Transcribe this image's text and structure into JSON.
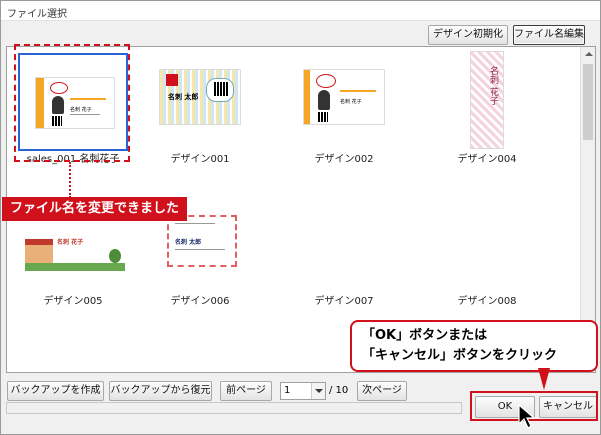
{
  "window": {
    "title": "ファイル選択"
  },
  "toolbar": {
    "design_reset": "デザイン初期化",
    "file_rename": "ファイル名編集"
  },
  "thumbnails": [
    {
      "label": "sales_001 名刺花子",
      "selected": true,
      "card": {
        "name": "名刺 花子",
        "accent": "#f5a623"
      }
    },
    {
      "label": "デザイン001",
      "selected": false,
      "card": {
        "name": "名刺 太郎"
      }
    },
    {
      "label": "デザイン002",
      "selected": false,
      "card": {
        "name": "名刺 花子"
      }
    },
    {
      "label": "デザイン004",
      "selected": false,
      "card": {
        "name": "名刺 花子"
      }
    },
    {
      "label": "デザイン005",
      "selected": false,
      "card": {
        "name": "名刺 花子"
      }
    },
    {
      "label": "デザイン006",
      "selected": false,
      "card": {
        "name": "名刺 太郎"
      }
    },
    {
      "label": "デザイン007",
      "selected": false
    },
    {
      "label": "デザイン008",
      "selected": false
    }
  ],
  "bottom": {
    "backup_create": "バックアップを作成",
    "backup_restore": "バックアップから復元",
    "prev_page": "前ページ",
    "page_value": "1",
    "page_total": "/ 10",
    "next_page": "次ページ",
    "ok": "OK",
    "cancel": "キャンセル"
  },
  "callouts": {
    "renamed": "ファイル名を変更できました",
    "instruction_line1": "「OK」ボタンまたは",
    "instruction_line2": "「キャンセル」ボタンをクリック"
  },
  "colors": {
    "callout_red": "#d0101a",
    "selection_blue": "#2a63d6"
  }
}
